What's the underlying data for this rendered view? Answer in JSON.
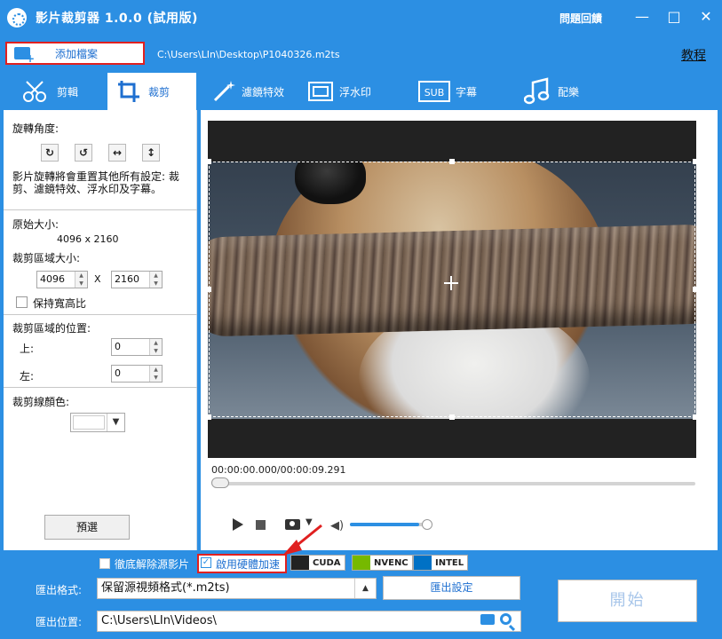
{
  "window": {
    "title": "影片裁剪器 1.0.0 (試用版)",
    "feedback": "問題回饋",
    "minimize_icon": "—",
    "maximize_icon": "□",
    "close_icon": "✕"
  },
  "toolbar": {
    "add_file_label": "添加檔案",
    "file_path": "C:\\Users\\LIn\\Desktop\\P1040326.m2ts",
    "tutorial_label": "教程"
  },
  "tabs": [
    {
      "label": "剪輯",
      "icon": "scissors-icon"
    },
    {
      "label": "裁剪",
      "icon": "crop-icon",
      "active": true
    },
    {
      "label": "濾鏡特效",
      "icon": "magic-wand-icon"
    },
    {
      "label": "浮水印",
      "icon": "watermark-icon"
    },
    {
      "label": "字幕",
      "icon": "subtitle-icon",
      "icon_text": "SUB"
    },
    {
      "label": "配樂",
      "icon": "music-icon"
    }
  ],
  "crop_panel": {
    "rotate_label": "旋轉角度:",
    "rotate_buttons": [
      "↻",
      "↺",
      "↔",
      "↕"
    ],
    "note": "影片旋轉將會重置其他所有設定: 裁剪、濾鏡特效、浮水印及字幕。",
    "original_size_label": "原始大小:",
    "original_size_value": "4096 x 2160",
    "crop_size_label": "裁剪區域大小:",
    "width": "4096",
    "x_sep": "X",
    "height": "2160",
    "keep_ratio_label": "保持寬高比",
    "position_label": "裁剪區域的位置:",
    "top_label": "上:",
    "top_value": "0",
    "left_label": "左:",
    "left_value": "0",
    "line_color_label": "裁剪線顏色:",
    "line_color": "#ffffff",
    "preset_label": "預選"
  },
  "player": {
    "current_time": "00:00:00.000",
    "total_time": "00:00:09.291",
    "time_sep": "/",
    "volume": 0.85,
    "camera_dropdown": "▼",
    "speaker_icon": "◀)"
  },
  "bottom": {
    "disable_source_label": "徹底解除源影片",
    "hw_accel_label": "啟用硬體加速",
    "hw_accel_checked": true,
    "gpu": [
      "CUDA",
      "NVENC",
      "INTEL"
    ],
    "format_label": "匯出格式:",
    "format_value": "保留源視頻格式(*.m2ts)",
    "export_settings_label": "匯出設定",
    "start_label": "開始",
    "location_label": "匯出位置:",
    "location_value": "C:\\Users\\LIn\\Videos\\"
  },
  "colors": {
    "accent": "#2c8fe3",
    "highlight": "#e02020"
  }
}
